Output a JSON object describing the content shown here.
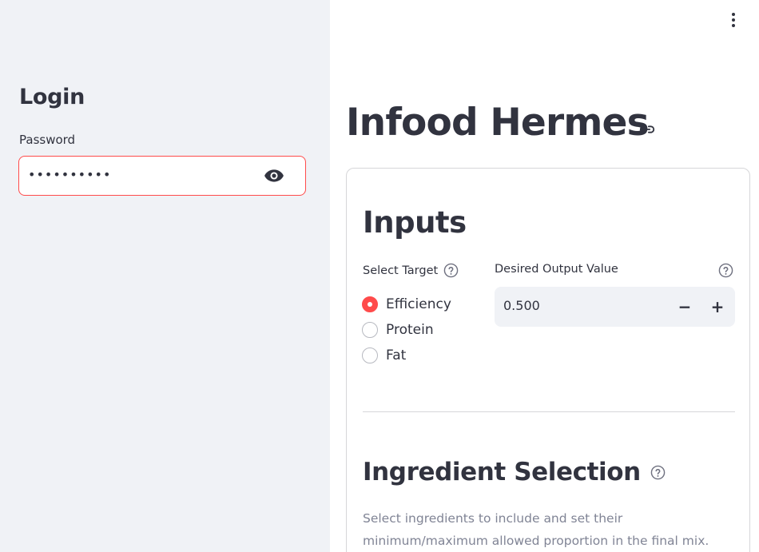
{
  "sidebar": {
    "title": "Login",
    "password_label": "Password",
    "password_value": "••••••••••"
  },
  "header": {
    "menu_icon": "vertical-ellipsis-icon"
  },
  "main": {
    "title": "Infood Hermes",
    "inputs": {
      "title": "Inputs",
      "target_label": "Select Target",
      "target_options": [
        "Efficiency",
        "Protein",
        "Fat"
      ],
      "selected_target": "Efficiency",
      "output_label": "Desired Output Value",
      "output_value": "0.500",
      "minus_label": "−",
      "plus_label": "+"
    },
    "ingredients": {
      "title": "Ingredient Selection",
      "description": "Select ingredients to include and set their minimum/maximum allowed proportion in the final mix."
    }
  },
  "colors": {
    "accent": "#ff4b4b",
    "sidebar_bg": "#f0f2f6",
    "text": "#31333f",
    "muted_text": "#808495"
  }
}
